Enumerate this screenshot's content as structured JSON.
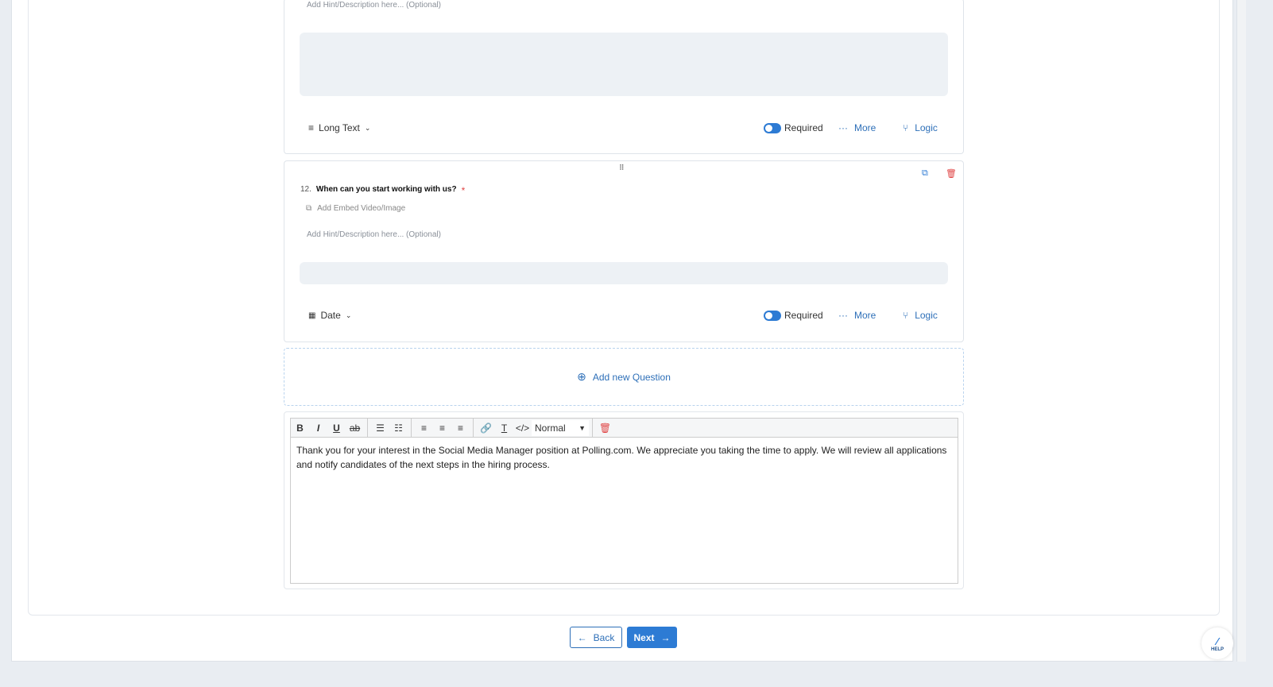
{
  "prev_question": {
    "hint": "Add Hint/Description here... (Optional)",
    "type": "Long Text",
    "required": "Required",
    "more": "More",
    "logic": "Logic"
  },
  "question": {
    "number": "12.",
    "title": "When can you start working with us?",
    "asterisk": "*",
    "embed": "Add Embed Video/Image",
    "hint": "Add Hint/Description here... (Optional)",
    "type": "Date",
    "required": "Required",
    "more": "More",
    "logic": "Logic"
  },
  "add_question": "Add new Question",
  "editor": {
    "format": "Normal",
    "text": "Thank you for your interest in the Social Media Manager position at Polling.com. We appreciate you taking the time to apply. We will review all applications and notify candidates of the next steps in the hiring process."
  },
  "nav": {
    "back": "Back",
    "next": "Next"
  },
  "help": "HELP",
  "colors": {
    "accent": "#2d7bd4",
    "danger": "#e04646"
  }
}
